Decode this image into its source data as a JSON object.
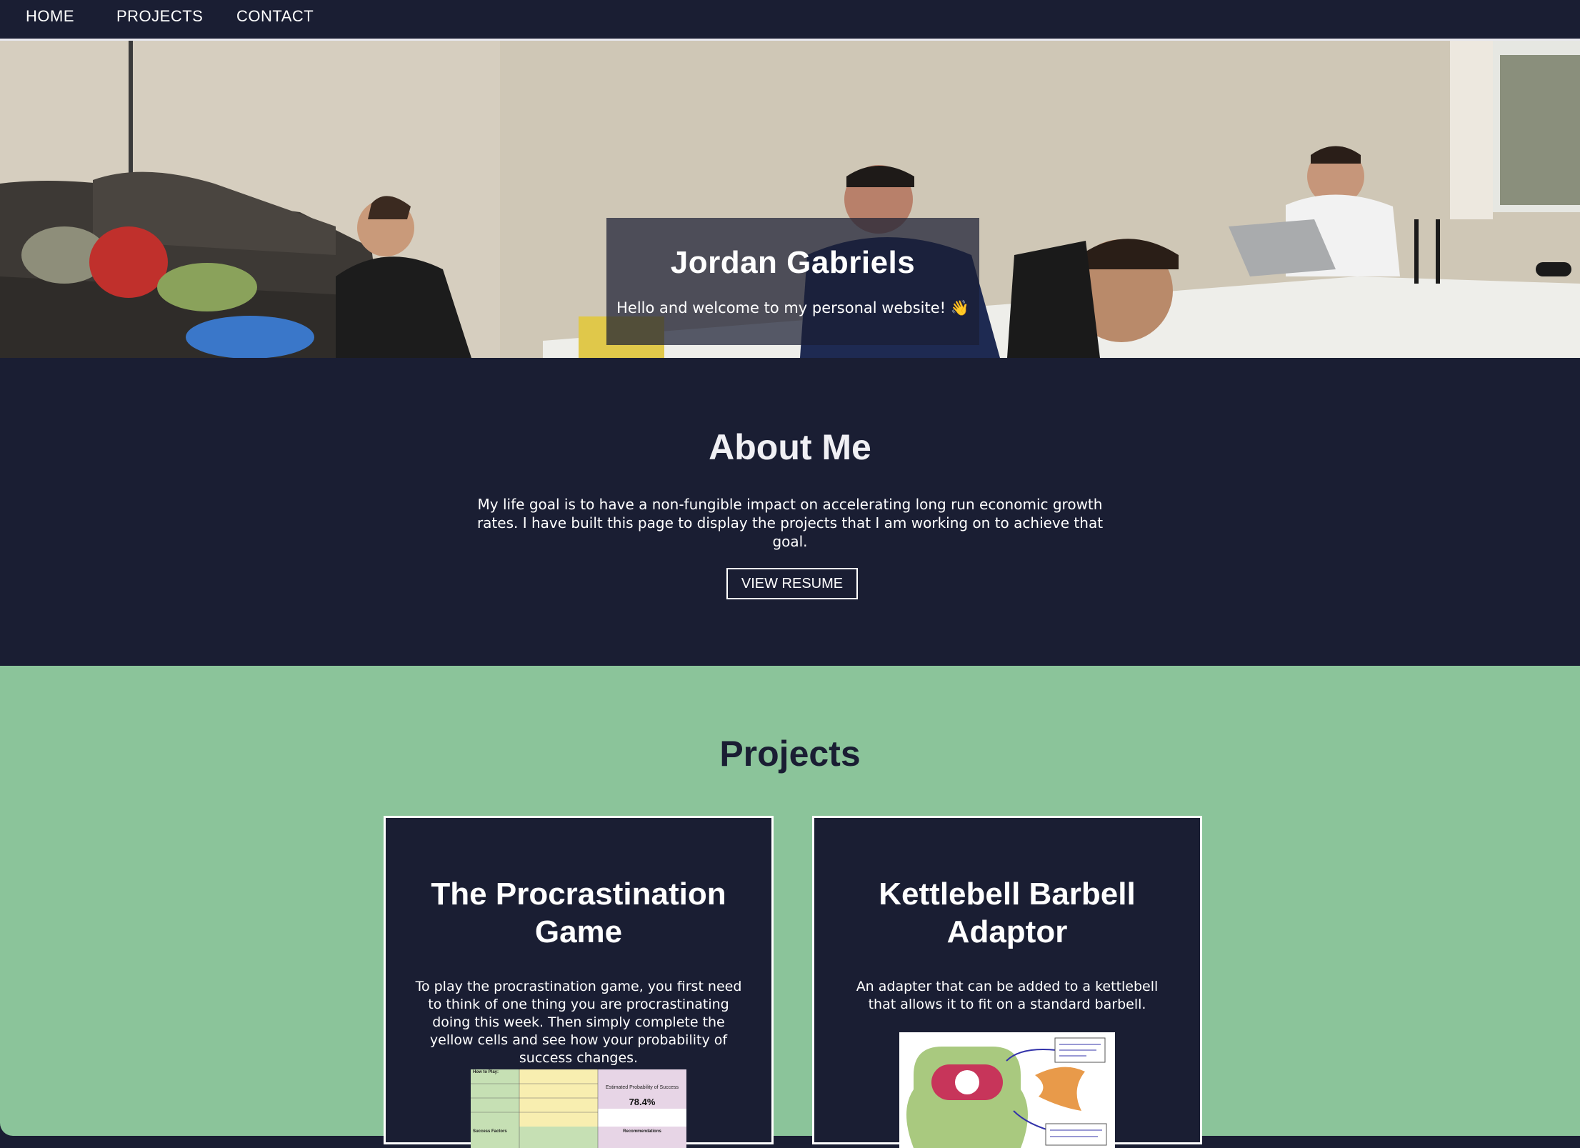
{
  "nav": {
    "items": [
      "HOME",
      "PROJECTS",
      "CONTACT"
    ]
  },
  "hero": {
    "title": "Jordan Gabriels",
    "subtitle": "Hello and welcome to my personal website! 👋"
  },
  "about": {
    "title": "About Me",
    "text": "My life goal is to have a non-fungible impact on accelerating long run economic growth rates. I have built this page to display the projects that I am working on to achieve that goal.",
    "button_label": "VIEW RESUME"
  },
  "projects": {
    "title": "Projects",
    "cards": [
      {
        "title": "The Procrastination Game",
        "text": "To play the procrastination game, you first need to think of one thing you are procrastinating doing this week. Then simply complete the yellow cells and see how your probability of success changes.",
        "image": {
          "how_to_play": "How to Play:",
          "prob_label": "Estimated Probability of Success",
          "prob_value": "78.4%",
          "success_factors": "Success Factors",
          "recommendations": "Recommendations"
        }
      },
      {
        "title": "Kettlebell Barbell Adaptor",
        "text": "An adapter that can be added to a kettlebell that allows it to fit on a standard barbell."
      }
    ]
  },
  "colors": {
    "navy": "#1a1e33",
    "green": "#8bc49a",
    "white": "#ffffff"
  }
}
